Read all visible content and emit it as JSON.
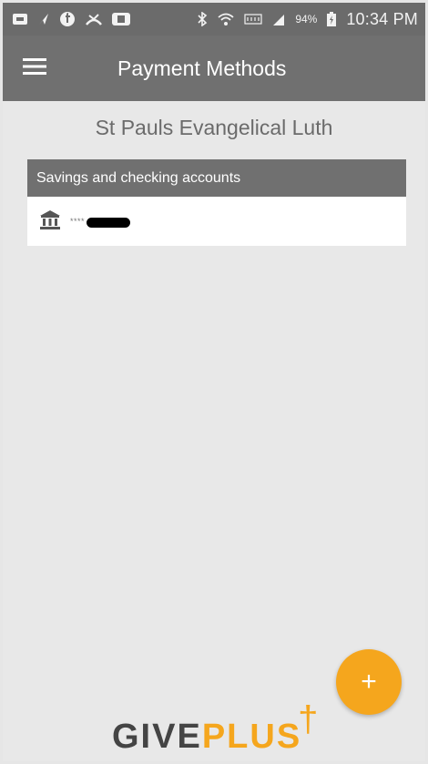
{
  "status_bar": {
    "battery_percent": "94%",
    "time": "10:34 PM",
    "icons": [
      "notification-icon",
      "navigation-icon",
      "facebook-icon",
      "missed-call-icon",
      "youtube-icon",
      "bluetooth-icon",
      "wifi-icon",
      "lte-icon",
      "signal-icon",
      "battery-charging-icon"
    ]
  },
  "app_bar": {
    "title": "Payment Methods",
    "menu_icon": "hamburger-menu-icon"
  },
  "organization": {
    "name": "St Pauls Evangelical Luth"
  },
  "accounts": {
    "section_title": "Savings and checking accounts",
    "items": [
      {
        "icon": "bank-icon",
        "masked_number": "****"
      }
    ]
  },
  "fab": {
    "label": "+"
  },
  "branding": {
    "logo_give": "GIVE",
    "logo_plus": "PLUS",
    "logo_mark": "†"
  },
  "colors": {
    "app_bar": "#707070",
    "status_bar": "#6b6b6b",
    "accent": "#f5a61d",
    "background": "#e8e8e8"
  }
}
